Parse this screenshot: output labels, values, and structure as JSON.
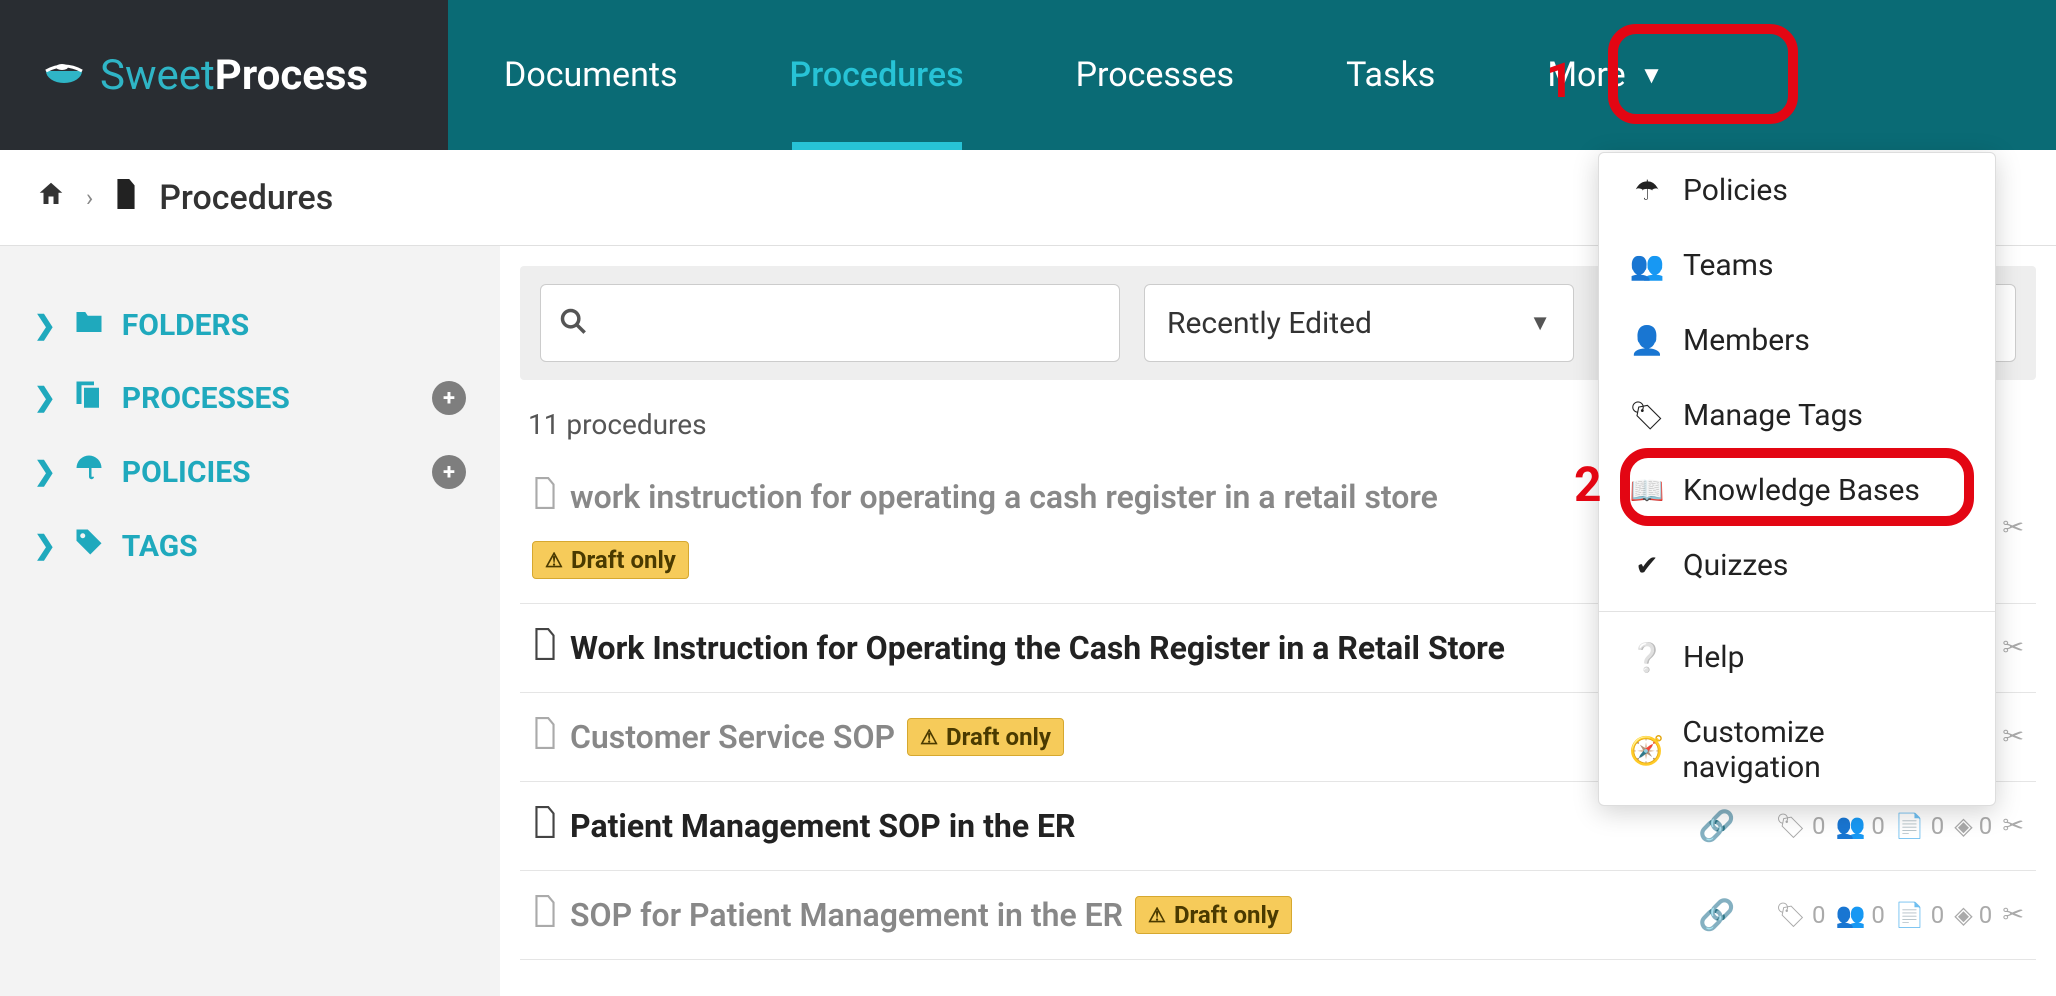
{
  "logo": {
    "light": "Sweet",
    "bold": "Process"
  },
  "nav": {
    "documents": "Documents",
    "procedures": "Procedures",
    "processes": "Processes",
    "tasks": "Tasks",
    "more": "More"
  },
  "breadcrumb": {
    "title": "Procedures"
  },
  "sidebar": {
    "folders": "FOLDERS",
    "processes": "PROCESSES",
    "policies": "POLICIES",
    "tags": "TAGS"
  },
  "filters": {
    "sort": "Recently Edited"
  },
  "list": {
    "count": "11 procedures",
    "draft_badge": "Draft only",
    "items": [
      {
        "title": "work instruction for operating a cash register in a retail store",
        "draft": true,
        "meta_visible": true
      },
      {
        "title": "Work Instruction for Operating the Cash Register in a Retail Store",
        "draft": false,
        "meta_visible": true
      },
      {
        "title": "Customer Service SOP",
        "draft": true,
        "meta_visible": true
      },
      {
        "title": "Patient Management SOP in the ER",
        "draft": false,
        "meta_visible": true
      },
      {
        "title": "SOP for Patient Management in the ER",
        "draft": true,
        "meta_visible": true
      }
    ],
    "meta_zero": "0"
  },
  "dropdown": {
    "policies": "Policies",
    "teams": "Teams",
    "members": "Members",
    "manage_tags": "Manage Tags",
    "knowledge_bases": "Knowledge Bases",
    "quizzes": "Quizzes",
    "help": "Help",
    "customize": "Customize navigation"
  },
  "annotations": {
    "one": "1",
    "two": "2"
  }
}
